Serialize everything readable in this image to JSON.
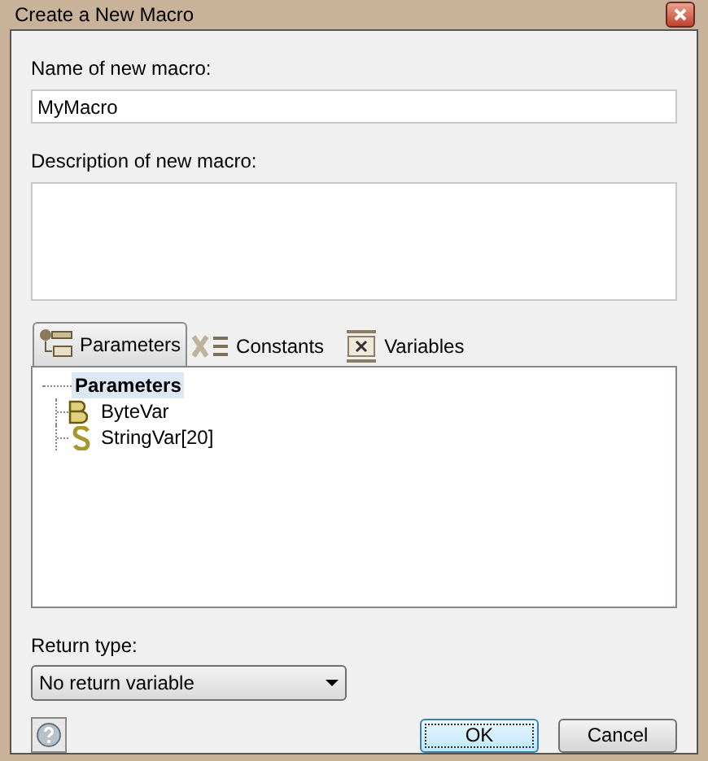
{
  "window": {
    "title": "Create a New Macro"
  },
  "name_field": {
    "label": "Name of new macro:",
    "value": "MyMacro"
  },
  "description_field": {
    "label": "Description of new macro:"
  },
  "tabs": [
    {
      "label": "Parameters",
      "kind": "parameters",
      "selected": true
    },
    {
      "label": "Constants",
      "kind": "constants",
      "selected": false
    },
    {
      "label": "Variables",
      "kind": "variables",
      "selected": false
    }
  ],
  "tree": [
    {
      "label": "Parameters",
      "selected": true,
      "children": [
        {
          "label": "ByteVar",
          "kind": "byte",
          "selected": false
        },
        {
          "label": "StringVar[20]",
          "kind": "string",
          "selected": false
        }
      ]
    }
  ],
  "return_type": {
    "label": "Return type:",
    "value": "No return variable"
  },
  "buttons": [
    {
      "label": "OK",
      "kind": "default"
    },
    {
      "label": "Cancel",
      "kind": "normal"
    }
  ]
}
